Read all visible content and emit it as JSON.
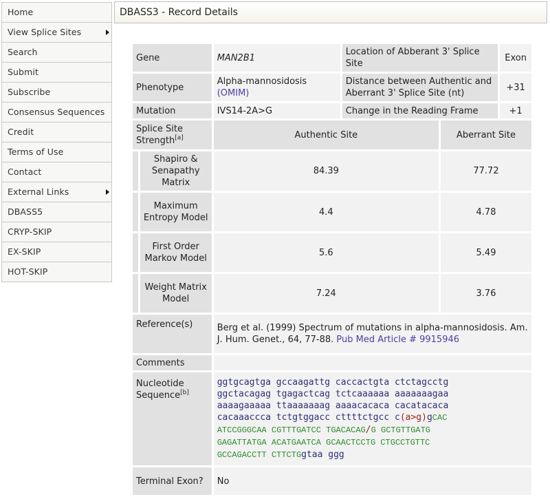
{
  "sidebar": {
    "items": [
      {
        "label": "Home",
        "submenu": false
      },
      {
        "label": "View Splice Sites",
        "submenu": true
      },
      {
        "label": "Search",
        "submenu": false
      },
      {
        "label": "Submit",
        "submenu": false
      },
      {
        "label": "Subscribe",
        "submenu": false
      },
      {
        "label": "Consensus Sequences",
        "submenu": false
      },
      {
        "label": "Credit",
        "submenu": false
      },
      {
        "label": "Terms of Use",
        "submenu": false
      },
      {
        "label": "Contact",
        "submenu": false
      },
      {
        "label": "External Links",
        "submenu": true
      },
      {
        "label": "DBASS5",
        "submenu": false
      },
      {
        "label": "CRYP-SKIP",
        "submenu": false
      },
      {
        "label": "EX-SKIP",
        "submenu": false
      },
      {
        "label": "HOT-SKIP",
        "submenu": false
      }
    ]
  },
  "header": {
    "title": "DBASS3 - Record Details"
  },
  "record": {
    "gene_label": "Gene",
    "gene": "MAN2B1",
    "location_label": "Location of Abberant 3' Splice Site",
    "location": "Exon",
    "phenotype_label": "Phenotype",
    "phenotype": "Alpha-mannosidosis",
    "omim_link": "(OMIM)",
    "distance_label": "Distance between Authentic and Aberrant 3' Splice Site (nt)",
    "distance": "+31",
    "mutation_label": "Mutation",
    "mutation": "IVS14-2A>G",
    "frame_label": "Change in the Reading Frame",
    "frame": "+1",
    "strength_label": "Splice Site Strength",
    "strength_note": "[a]",
    "authentic_header": "Authentic Site",
    "aberrant_header": "Aberrant Site",
    "strength_rows": [
      {
        "model": "Shapiro & Senapathy Matrix",
        "authentic": "84.39",
        "aberrant": "77.72"
      },
      {
        "model": "Maximum Entropy Model",
        "authentic": "4.4",
        "aberrant": "4.78"
      },
      {
        "model": "First Order Markov Model",
        "authentic": "5.6",
        "aberrant": "5.49"
      },
      {
        "model": "Weight Matrix Model",
        "authentic": "7.24",
        "aberrant": "3.76"
      }
    ],
    "reference_label": "Reference(s)",
    "reference_text": "Berg et al. (1999) Spectrum of mutations in alpha-mannosidosis. Am. J. Hum. Genet., 64, 77-88.",
    "pubmed_link": "Pub Med Article # 9915946",
    "comments_label": "Comments",
    "comments": "",
    "sequence_label": "Nucleotide Sequence",
    "sequence_note": "[b]",
    "sequence": {
      "line1": "ggtgcagtga gccaagattg caccactgta ctctagcctg",
      "line2": "ggctacagag tgagactcag tctcaaaaaa aaaaaaagaa",
      "line3": "aaaagaaaaa ttaaaaaaag aaaacacaca cacatacaca",
      "line4_intron": "cacaaaccca tctgtggacc cttttctgcc c",
      "line4_mut": "(a>g)",
      "line4_intron2": "g",
      "line4_exon": "CAC",
      "line5a": "ATCCGGGCAA CGTTTGATCC TGACACAG",
      "line5_slash": "/",
      "line5b": "G GCTGTTGATG",
      "line6": "GAGATTATGA ACATGAATCA GCAACTCCTG CTGCCTGTTC",
      "line7_exon": "GCCAGACCTT CTTCTG",
      "line7_intron": "gtaa ggg"
    },
    "terminal_label": "Terminal Exon?",
    "terminal": "No"
  }
}
